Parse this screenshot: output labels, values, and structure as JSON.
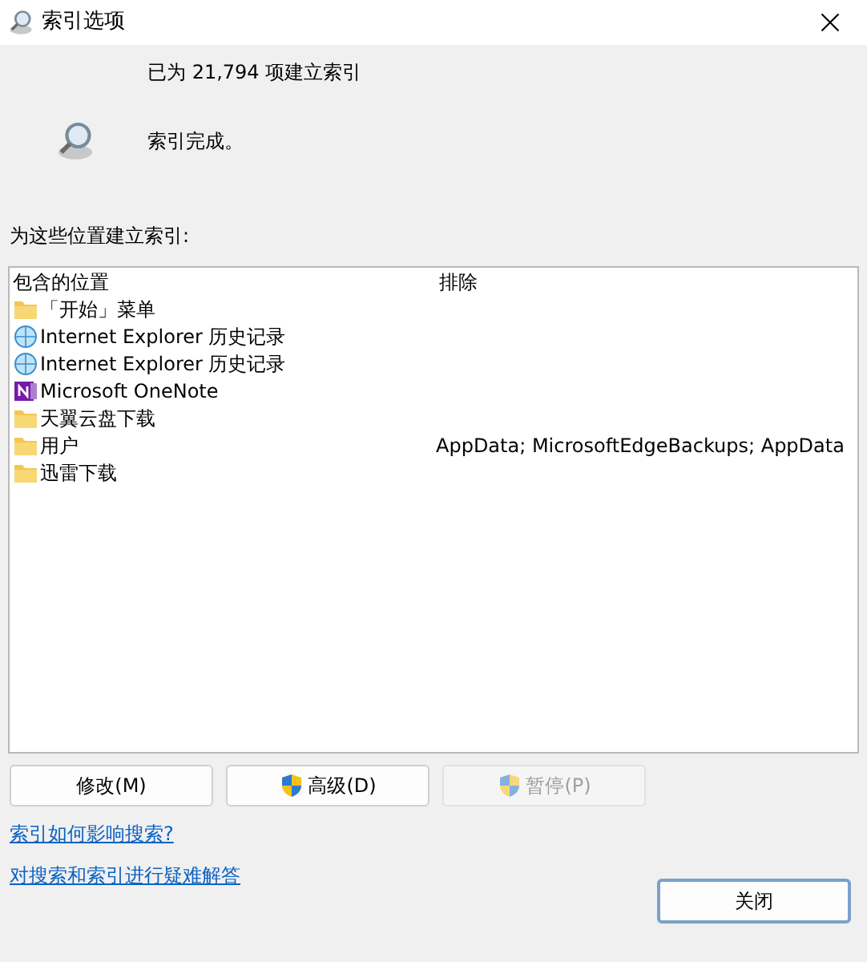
{
  "window": {
    "title": "索引选项"
  },
  "status": {
    "count_text": "已为 21,794 项建立索引",
    "state_text": "索引完成。"
  },
  "locations_label": "为这些位置建立索引:",
  "table": {
    "columns": [
      "包含的位置",
      "排除"
    ],
    "rows": [
      {
        "kind": "folder",
        "location": "「开始」菜单",
        "exclude": ""
      },
      {
        "kind": "browser",
        "location": "Internet Explorer 历史记录",
        "exclude": ""
      },
      {
        "kind": "browser",
        "location": "Internet Explorer 历史记录",
        "exclude": ""
      },
      {
        "kind": "notes",
        "location": "Microsoft OneNote",
        "exclude": ""
      },
      {
        "kind": "folder",
        "location": "天翼云盘下载",
        "exclude": ""
      },
      {
        "kind": "folder",
        "location": "用户",
        "exclude": "AppData; MicrosoftEdgeBackups; AppData"
      },
      {
        "kind": "folder",
        "location": "迅雷下载",
        "exclude": ""
      }
    ]
  },
  "buttons": [
    {
      "label": "修改(M)",
      "shield": false,
      "disabled": false
    },
    {
      "label": "高级(D)",
      "shield": true,
      "disabled": false
    },
    {
      "label": "暂停(P)",
      "shield": true,
      "disabled": true
    }
  ],
  "links": [
    "索引如何影响搜索?",
    "对搜索和索引进行疑难解答"
  ],
  "close_button": {
    "label": "关闭",
    "default": true
  }
}
